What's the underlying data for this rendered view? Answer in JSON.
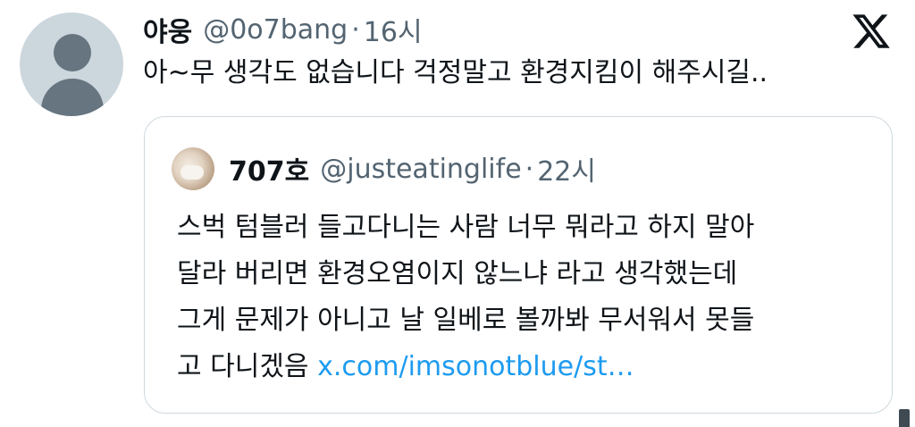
{
  "tweet": {
    "display_name": "야웅",
    "handle": "@0o7bang",
    "separator": "·",
    "time": "16시",
    "text": "아~무 생각도 없습니다 걱정말고 환경지킴이 해주시길..",
    "avatar_icon": "default-profile-icon"
  },
  "brand": {
    "logo_icon": "x-logo-icon"
  },
  "quote": {
    "display_name": "707호",
    "handle": "@justeatinglife",
    "separator": "·",
    "time": "22시",
    "lines": [
      "스벅 텀블러 들고다니는 사람 너무 뭐라고 하지 말아",
      "달라 버리면 환경오염이지 않느냐 라고 생각했는데",
      "그게 문제가 아니고 날 일베로 볼까봐 무서워서 못들",
      "고 다니겠음"
    ],
    "link": "x.com/imsonotblue/st…"
  },
  "colors": {
    "text": "#0f1419",
    "secondary": "#536471",
    "link": "#1d9bf0",
    "border": "#cfd9de"
  }
}
